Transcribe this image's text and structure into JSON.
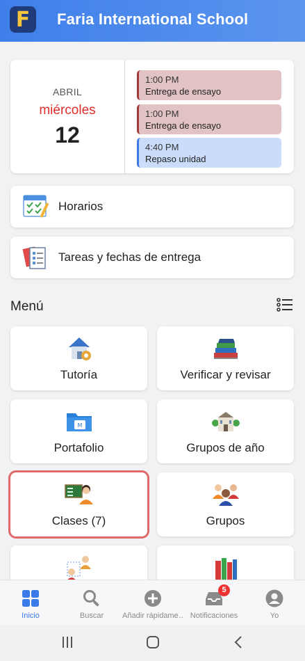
{
  "header": {
    "logo_letter": "F",
    "title": "Faria International School"
  },
  "calendar": {
    "month": "ABRIL",
    "weekday": "miércoles",
    "day": "12",
    "events": [
      {
        "time": "1:00 PM",
        "title": "Entrega de ensayo",
        "color": "#e2c3c4"
      },
      {
        "time": "1:00 PM",
        "title": "Entrega de ensayo",
        "color": "#e2c3c4"
      },
      {
        "time": "4:40 PM",
        "title": "Repaso unidad",
        "color": "#cbdcfb"
      }
    ]
  },
  "shortcuts": [
    {
      "label": "Horarios",
      "icon": "schedule-checklist-icon"
    },
    {
      "label": "Tareas y fechas de entrega",
      "icon": "tasks-documents-icon"
    }
  ],
  "menu": {
    "title": "Menú",
    "tiles": [
      {
        "label": "Tutoría",
        "icon": "house-gear-icon"
      },
      {
        "label": "Verificar y revisar",
        "icon": "book-stack-icon"
      },
      {
        "label": "Portafolio",
        "icon": "folder-icon"
      },
      {
        "label": "Grupos de año",
        "icon": "school-building-icon"
      },
      {
        "label": "Clases (7)",
        "icon": "classroom-teacher-icon"
      },
      {
        "label": "Grupos",
        "icon": "people-group-icon"
      },
      {
        "label": "",
        "icon": "org-chart-people-icon"
      },
      {
        "label": "",
        "icon": "bookshelf-icon"
      }
    ]
  },
  "bottom_nav": [
    {
      "label": "Inicio",
      "icon": "grid-icon",
      "active": true
    },
    {
      "label": "Buscar",
      "icon": "search-icon"
    },
    {
      "label": "Añadir rápidame…",
      "icon": "plus-circle-icon"
    },
    {
      "label": "Notificaciones",
      "icon": "inbox-icon",
      "badge": "5"
    },
    {
      "label": "Yo",
      "icon": "user-icon"
    }
  ],
  "colors": {
    "header": "#3f7fea",
    "accent": "#3a7be8",
    "weekday": "#e02d2d",
    "badge": "#ee3333"
  }
}
